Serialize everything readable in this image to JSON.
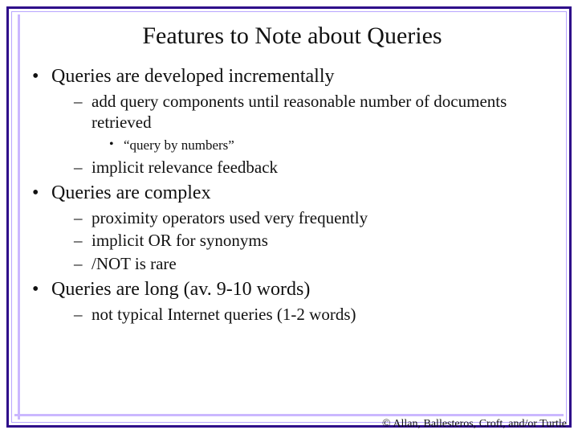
{
  "title": "Features to Note about Queries",
  "bullets": {
    "i0": {
      "text": "Queries are developed incrementally",
      "sub": {
        "i0": {
          "text": "add query components until reasonable number of documents retrieved",
          "sub": {
            "i0": {
              "text": "“query by numbers”"
            }
          }
        },
        "i1": {
          "text": "implicit relevance feedback"
        }
      }
    },
    "i1": {
      "text": "Queries are complex",
      "sub": {
        "i0": {
          "text": "proximity operators used very frequently"
        },
        "i1": {
          "text": "implicit OR for synonyms"
        },
        "i2": {
          "text": "/NOT is rare"
        }
      }
    },
    "i2": {
      "text": "Queries are long (av. 9-10 words)",
      "sub": {
        "i0": {
          "text": "not typical Internet queries (1-2 words)"
        }
      }
    }
  },
  "footer": "© Allan, Ballesteros, Croft, and/or Turtle"
}
